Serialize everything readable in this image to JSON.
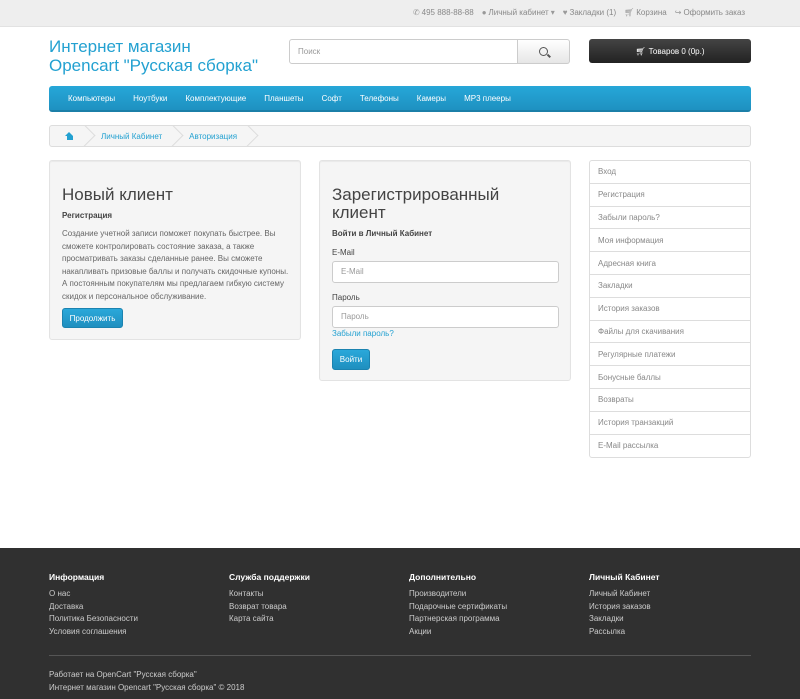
{
  "topbar": {
    "phone": "495 888-88-88",
    "account": "Личный кабинет",
    "wishlist": "Закладки (1)",
    "cart": "Корзина",
    "checkout": "Оформить заказ"
  },
  "header": {
    "logo_line1": "Интернет магазин",
    "logo_line2": "Opencart \"Русская сборка\"",
    "search_placeholder": "Поиск",
    "cart_button": "Товаров 0 (0р.)"
  },
  "menu": [
    "Компьютеры",
    "Ноутбуки",
    "Комплектующие",
    "Планшеты",
    "Софт",
    "Телефоны",
    "Камеры",
    "MP3 плееры"
  ],
  "breadcrumb": [
    "Личный Кабинет",
    "Авторизация"
  ],
  "new_customer": {
    "title": "Новый клиент",
    "subtitle": "Регистрация",
    "description": "Создание учетной записи поможет покупать быстрее. Вы сможете контролировать состояние заказа, а также просматривать заказы сделанные ранее. Вы сможете накапливать призовые баллы и получать скидочные купоны. А постоянным покупателям мы предлагаем гибкую систему скидок и персональное обслуживание.",
    "button": "Продолжить"
  },
  "returning_customer": {
    "title": "Зарегистрированный клиент",
    "subtitle": "Войти в Личный Кабинет",
    "email_label": "E-Mail",
    "email_placeholder": "E-Mail",
    "password_label": "Пароль",
    "password_placeholder": "Пароль",
    "forgot_link": "Забыли пароль?",
    "button": "Войти"
  },
  "sidebar": [
    "Вход",
    "Регистрация",
    "Забыли пароль?",
    "Моя информация",
    "Адресная книга",
    "Закладки",
    "История заказов",
    "Файлы для скачивания",
    "Регулярные платежи",
    "Бонусные баллы",
    "Возвраты",
    "История транзакций",
    "E-Mail рассылка"
  ],
  "footer": {
    "columns": [
      {
        "title": "Информация",
        "links": [
          "О нас",
          "Доставка",
          "Политика Безопасности",
          "Условия соглашения"
        ]
      },
      {
        "title": "Служба поддержки",
        "links": [
          "Контакты",
          "Возврат товара",
          "Карта сайта"
        ]
      },
      {
        "title": "Дополнительно",
        "links": [
          "Производители",
          "Подарочные сертификаты",
          "Партнерская программа",
          "Акции"
        ]
      },
      {
        "title": "Личный Кабинет",
        "links": [
          "Личный Кабинет",
          "История заказов",
          "Закладки",
          "Рассылка"
        ]
      }
    ],
    "powered_line1": "Работает на OpenCart \"Русская сборка\"",
    "powered_line2": "Интернет магазин Opencart \"Русская сборка\" © 2018"
  },
  "colors": {
    "accent": "#23a1d1",
    "footer_bg": "#303030",
    "menu_bg": "#229ac8"
  }
}
